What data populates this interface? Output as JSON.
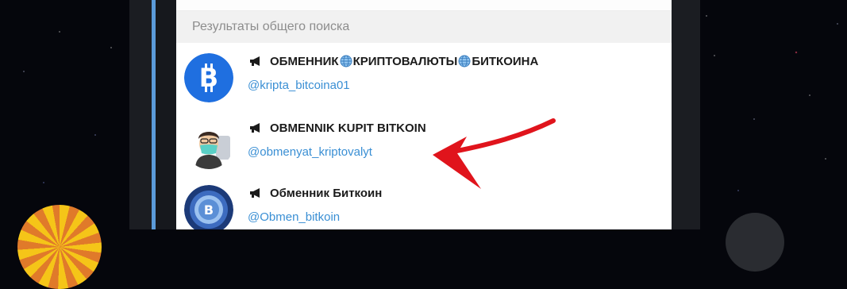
{
  "section_header": "Результаты общего поиска",
  "results": [
    {
      "name_parts": [
        "ОБМЕННИК",
        "КРИПТОВАЛЮТЫ",
        "БИТКОИНА"
      ],
      "handle": "@kripta_bitcoina01",
      "avatar": "bitcoin-logo"
    },
    {
      "name_parts": [
        "OBMENNIK KUPIT BITKOIN"
      ],
      "handle": "@obmenyat_kriptovalyt",
      "avatar": "cartoon-man-with-mask"
    },
    {
      "name_parts": [
        "Обменник Биткоин"
      ],
      "handle": "@Obmen_bitkoin",
      "avatar": "bitcoin-coin-graphic"
    }
  ],
  "icons": {
    "channel": "megaphone-icon",
    "separator": "globe-emoji"
  },
  "colors": {
    "accent_bar": "#5b9bd9",
    "handle_link": "#3a8fd4",
    "bitcoin_avatar": "#1f6fe0",
    "annotation_arrow": "#e0141c"
  }
}
